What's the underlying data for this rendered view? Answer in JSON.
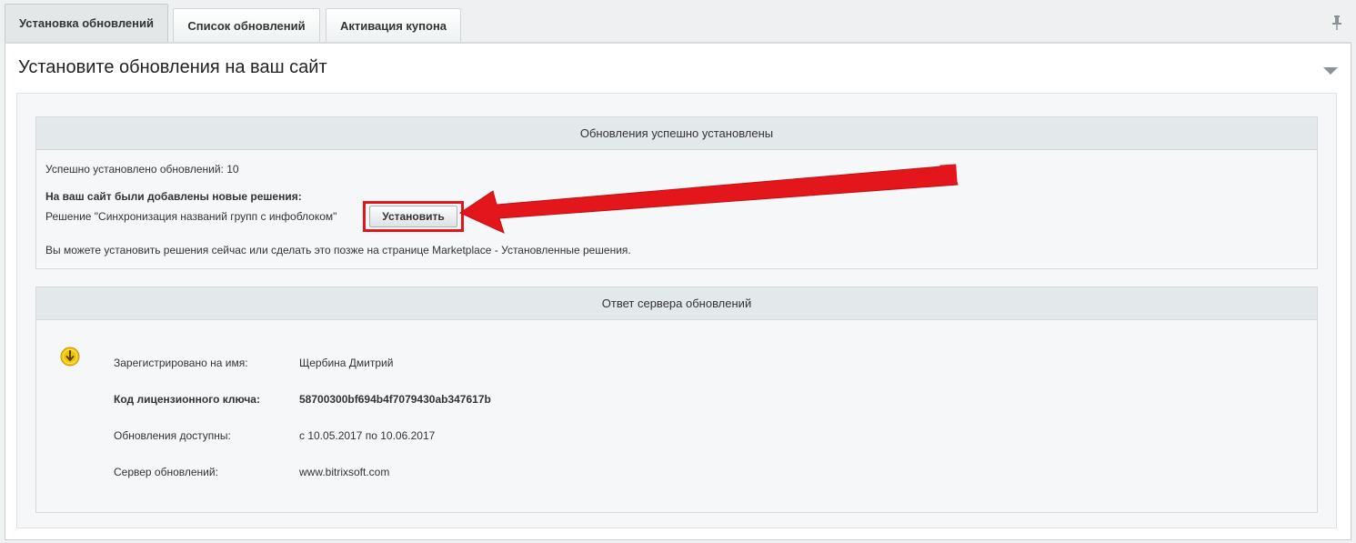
{
  "tabs": [
    {
      "label": "Установка обновлений",
      "active": true
    },
    {
      "label": "Список обновлений",
      "active": false
    },
    {
      "label": "Активация купона",
      "active": false
    }
  ],
  "panel": {
    "title": "Установите обновления на ваш сайт"
  },
  "success_box": {
    "header": "Обновления успешно установлены",
    "installed_count_text": "Успешно установлено обновлений: 10",
    "new_solutions_heading": "На ваш сайт были добавлены новые решения:",
    "solution_text": "Решение \"Синхронизация названий групп с инфоблоком\"",
    "install_button_label": "Установить",
    "footer_text": "Вы можете установить решения сейчас или сделать это позже на странице Marketplace - Установленные решения."
  },
  "server_box": {
    "header": "Ответ сервера обновлений",
    "rows": [
      {
        "key": "Зарегистрировано на имя:",
        "value": "Щербина Дмитрий",
        "bold": false
      },
      {
        "key": "Код лицензионного ключа:",
        "value": "58700300bf694b4f7079430ab347617b",
        "bold": true
      },
      {
        "key": "Обновления доступны:",
        "value": "с 10.05.2017 по 10.06.2017",
        "bold": false
      },
      {
        "key": "Сервер обновлений:",
        "value": "www.bitrixsoft.com",
        "bold": false
      }
    ]
  },
  "icons": {
    "pin": "pin-icon",
    "collapse": "chevron-down-icon",
    "server_status": "download-arrow-icon"
  },
  "colors": {
    "annotation_red": "#e3161c",
    "status_icon": "#f2c200"
  }
}
